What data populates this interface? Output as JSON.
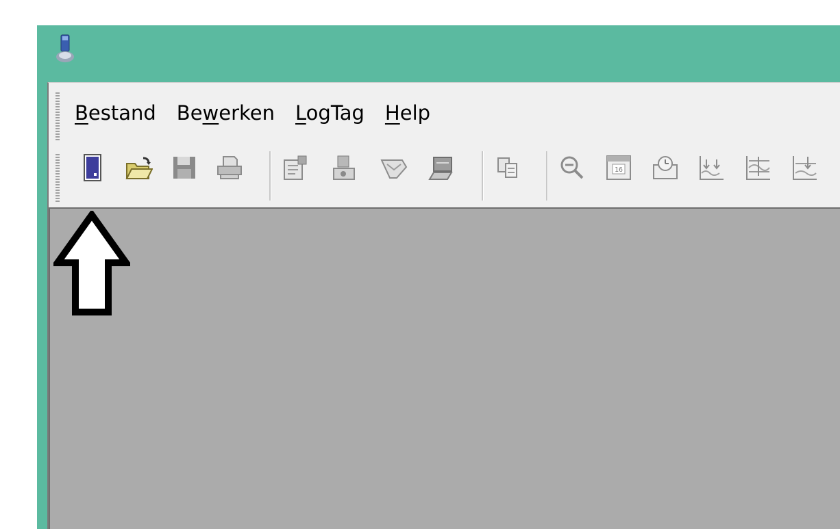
{
  "menu": {
    "items": [
      {
        "id": "bestand",
        "accel": "B",
        "rest": "estand"
      },
      {
        "id": "bewerken",
        "prefix": "Be",
        "accel": "w",
        "rest": "erken"
      },
      {
        "id": "logtag",
        "accel": "L",
        "rest": "ogTag"
      },
      {
        "id": "help",
        "accel": "H",
        "rest": "elp"
      }
    ]
  },
  "toolbar": {
    "buttons": [
      {
        "name": "download-logger-icon",
        "enabled": true
      },
      {
        "name": "open-folder-icon",
        "enabled": true
      },
      {
        "name": "save-icon",
        "enabled": false
      },
      {
        "name": "print-icon",
        "enabled": false
      },
      {
        "name": "configure-icon",
        "enabled": false
      },
      {
        "name": "logger-settings-icon",
        "enabled": false
      },
      {
        "name": "tag-icon",
        "enabled": false
      },
      {
        "name": "network-icon",
        "enabled": false
      },
      {
        "name": "copy-icon",
        "enabled": false
      },
      {
        "name": "zoom-out-icon",
        "enabled": false
      },
      {
        "name": "calendar-icon",
        "enabled": false
      },
      {
        "name": "clock-icon",
        "enabled": false
      },
      {
        "name": "chart-markers-icon",
        "enabled": false
      },
      {
        "name": "chart-limits-icon",
        "enabled": false
      },
      {
        "name": "chart-limits-2-icon",
        "enabled": false
      }
    ],
    "calendar_day": "16"
  },
  "colors": {
    "titlebar": "#5bbaa0",
    "workspace": "#ababab",
    "toolbar_bg": "#f0f0f0",
    "download_icon": "#3e3e9c",
    "folder_icon": "#e6dc8a"
  }
}
